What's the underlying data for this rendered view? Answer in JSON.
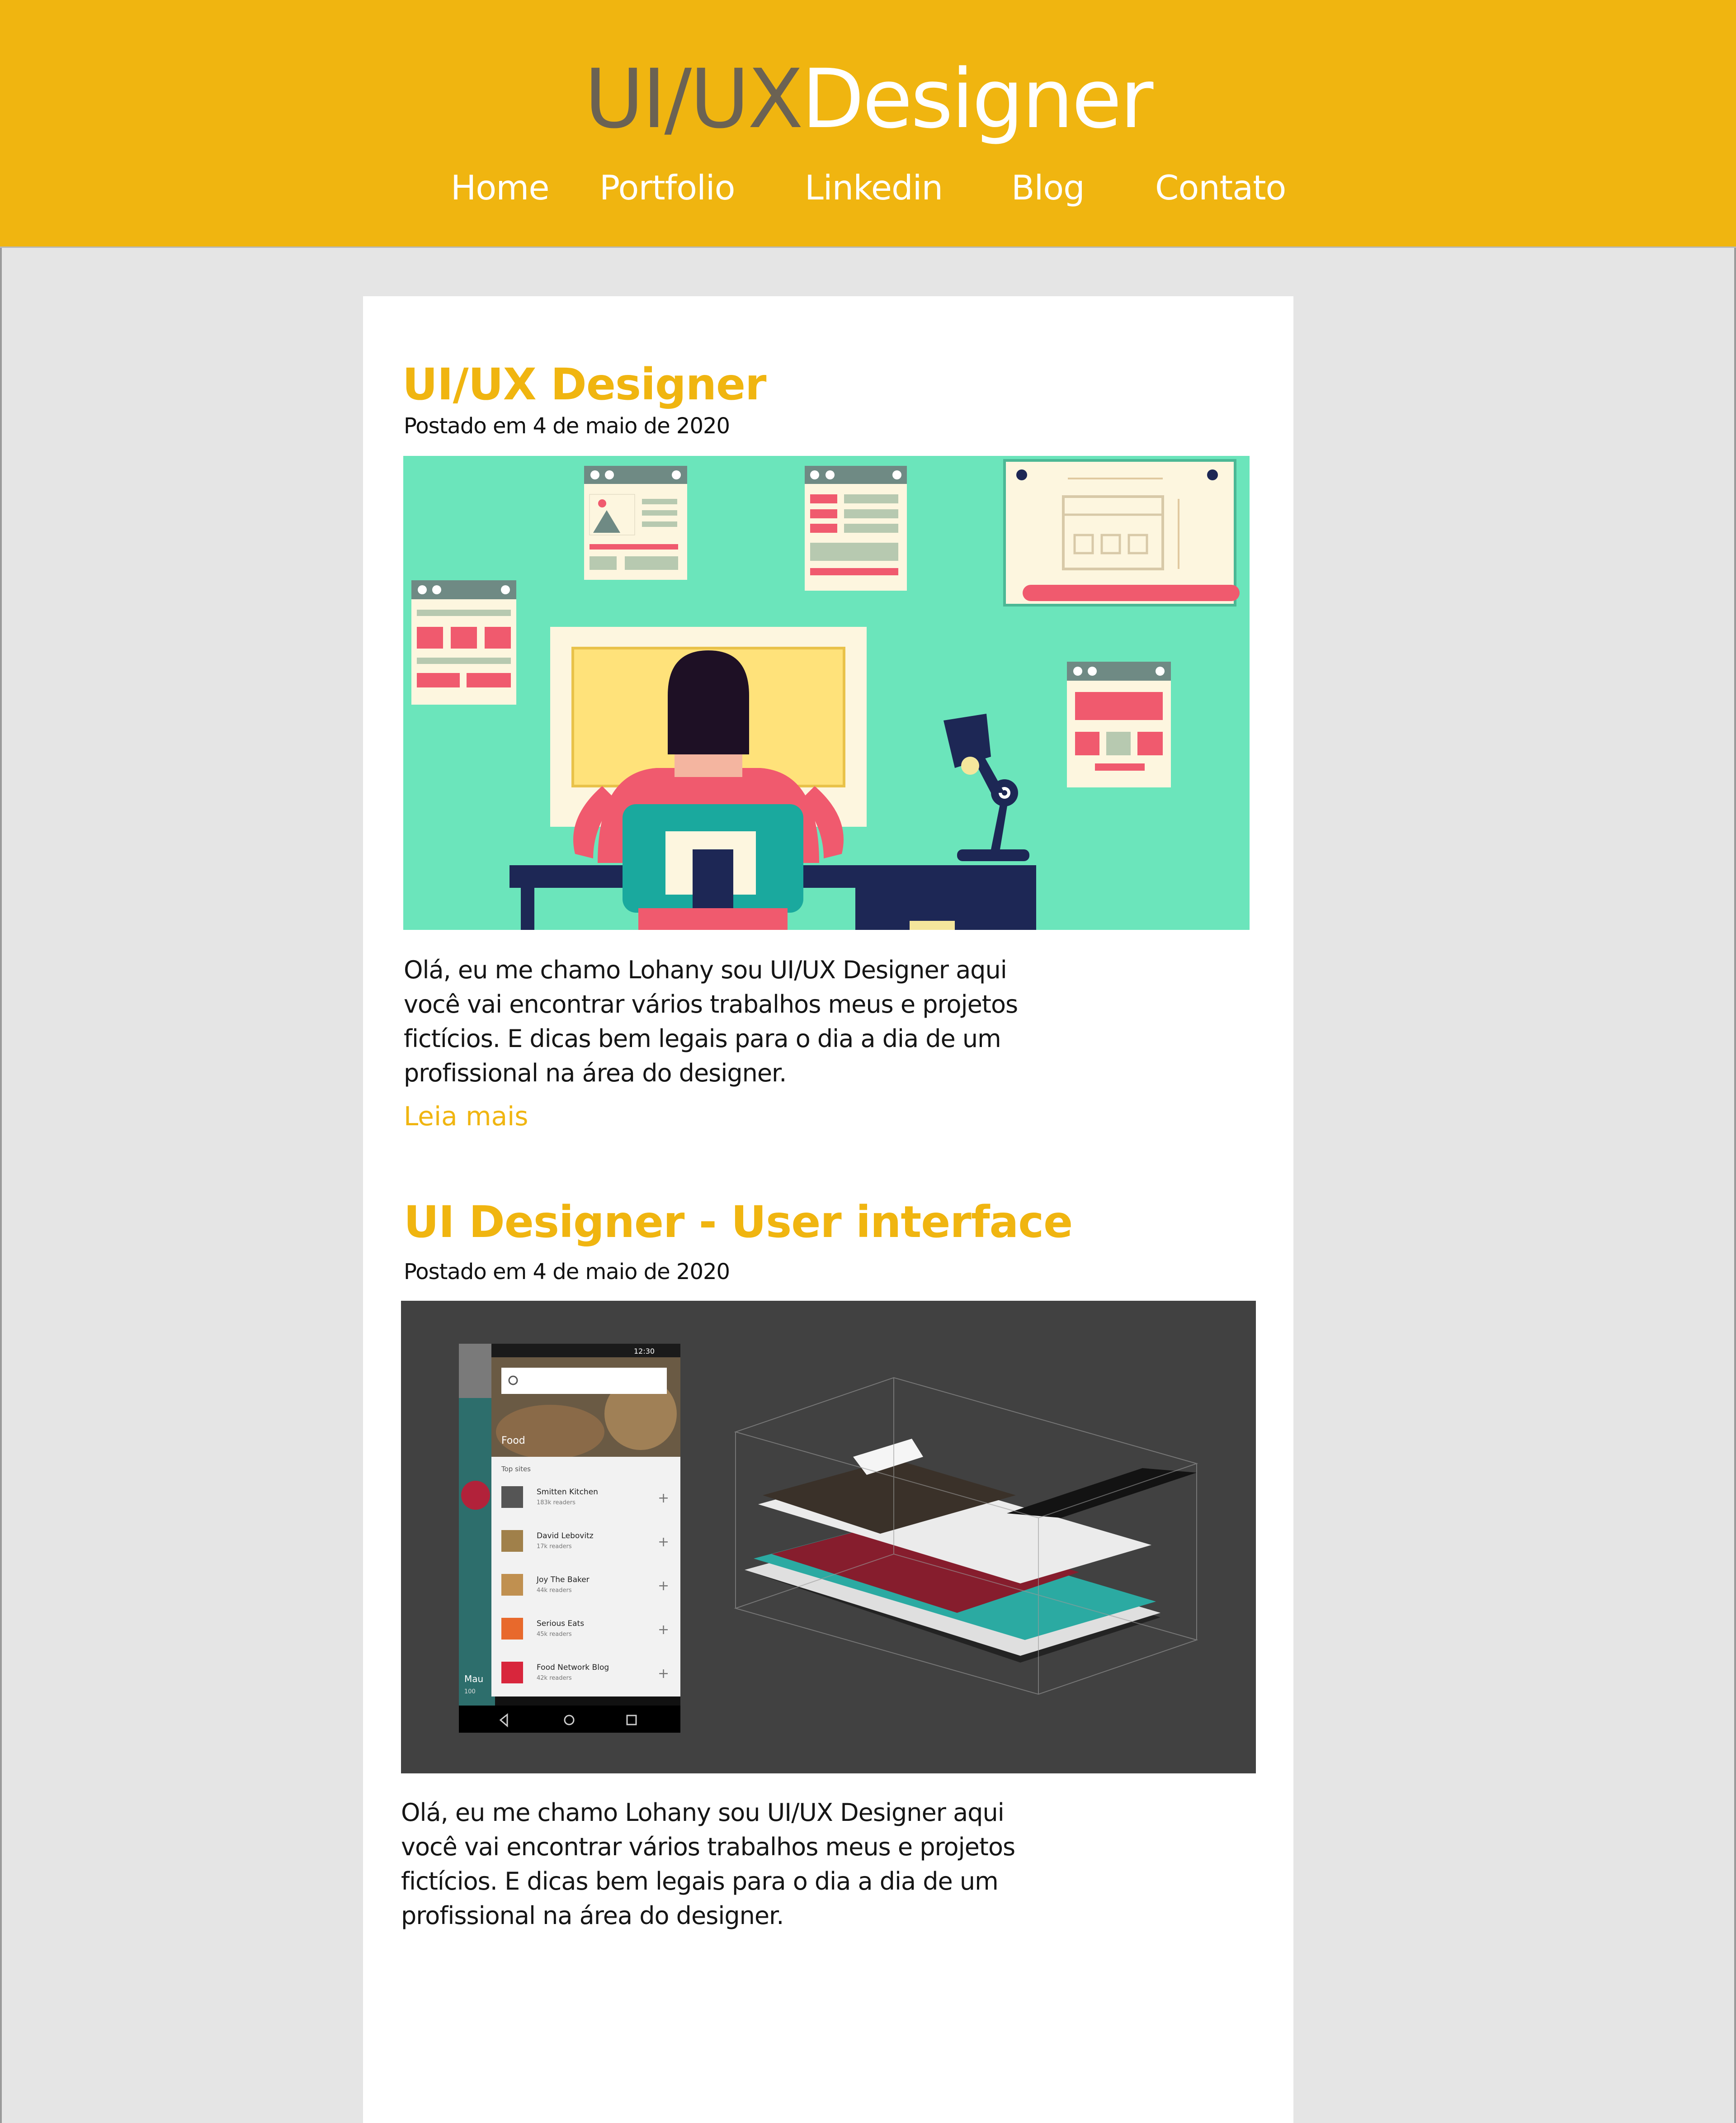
{
  "header": {
    "brand_part1": "UI/UX",
    "brand_part2": "Designer",
    "nav": [
      "Home",
      "Portfolio",
      "Linkedin",
      "Blog",
      "Contato"
    ]
  },
  "posts": [
    {
      "title": "UI/UX Designer",
      "date": "Postado em 4 de maio de 2020",
      "body": "Olá, eu me chamo Lohany sou UI/UX Designer aqui você vai encontrar vários trabalhos meus e projetos fictícios. E dicas bem legais para o dia a dia de um profissional na área do designer.",
      "read_more": "Leia mais"
    },
    {
      "title": "UI Designer - User interface",
      "date": "Postado em 4 de maio de 2020",
      "body": "Olá, eu me chamo Lohany sou UI/UX Designer aqui você vai encontrar vários trabalhos meus e projetos fictícios. E dicas bem legais para o dia a dia de um profissional na área do designer."
    }
  ],
  "phone": {
    "time": "12:30",
    "header_label": "Food",
    "section_label": "Top sites",
    "sites": [
      {
        "name": "Smitten Kitchen",
        "readers": "183k readers"
      },
      {
        "name": "David Lebovitz",
        "readers": "17k readers"
      },
      {
        "name": "Joy The Baker",
        "readers": "44k readers"
      },
      {
        "name": "Serious Eats",
        "readers": "45k readers"
      },
      {
        "name": "Food Network Blog",
        "readers": "42k readers"
      }
    ],
    "side_label": "Mau",
    "side_sub": "100"
  },
  "colors": {
    "header_bg": "#f0b510",
    "brand_dark": "#6b6253",
    "accent": "#f0b510",
    "page_bg": "#e5e5e5",
    "illustration_bg": "#6be5bb"
  }
}
